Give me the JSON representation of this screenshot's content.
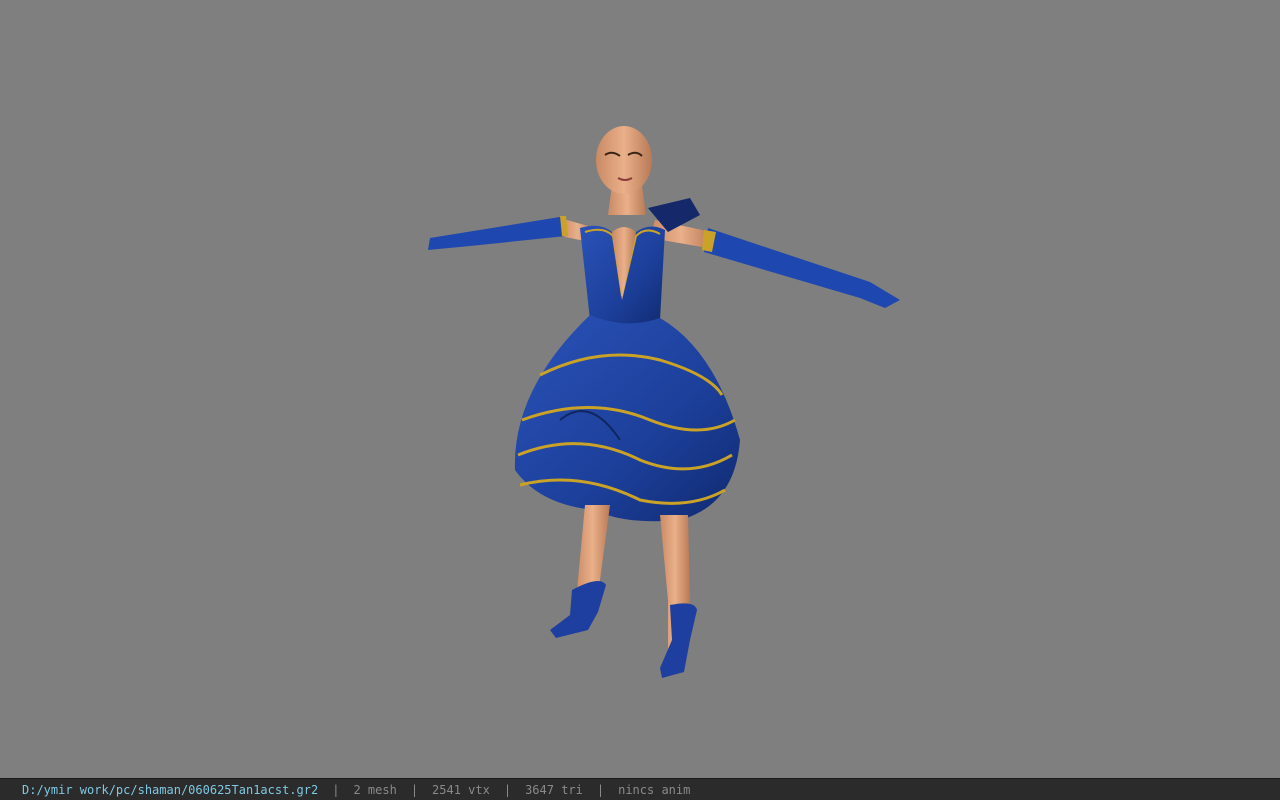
{
  "status": {
    "file_path": "D:/ymir work/pc/shaman/060625Tan1acst.gr2",
    "separator": "|",
    "mesh_count": "2 mesh",
    "vertex_count": "2541 vtx",
    "triangle_count": "3647 tri",
    "anim_label": "nincs anim"
  },
  "colors": {
    "background": "#7f7f7f",
    "statusbar": "#2b2b2b",
    "path_text": "#7ec8e3",
    "dress_blue": "#1c3f9a",
    "gold_trim": "#c9a227",
    "skin": "#e0a47c"
  }
}
